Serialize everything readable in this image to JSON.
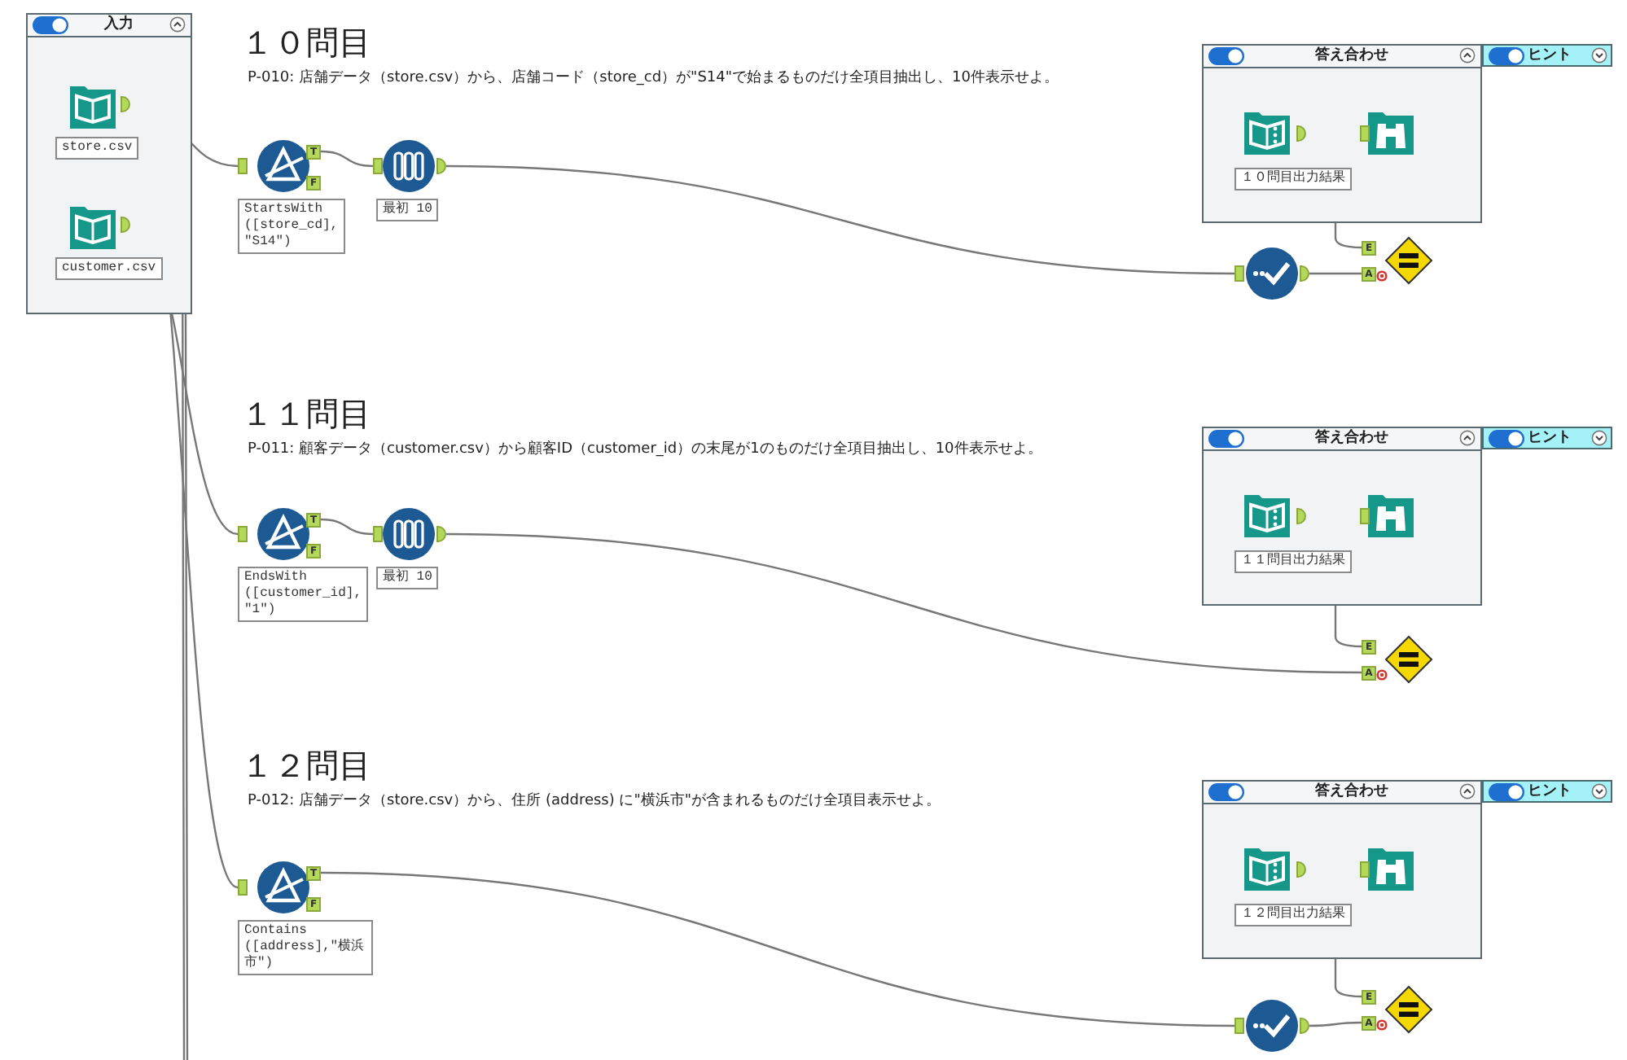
{
  "input_container": {
    "title": "入力",
    "on": true,
    "expanded": true,
    "tools": [
      {
        "kind": "input",
        "label": "store.csv"
      },
      {
        "kind": "input",
        "label": "customer.csv"
      }
    ]
  },
  "questions": [
    {
      "title": "１０問目",
      "description": "P-010: 店舗データ（store.csv）から、店舗コード（store_cd）が\"S14\"で始まるものだけ全項目抽出し、10件表示せよ。",
      "nodes": [
        {
          "kind": "filter",
          "label": "StartsWith\n([store_cd],\n\"S14\")",
          "ports": [
            "T",
            "F"
          ]
        },
        {
          "kind": "sample",
          "label": "最初 10"
        },
        {
          "kind": "check"
        }
      ],
      "answer": {
        "title": "答え合わせ",
        "on": true,
        "expanded": true,
        "result_label": "１０問目出力結果"
      },
      "compare_ports": [
        "E",
        "A"
      ],
      "hint": {
        "title": "ヒント",
        "on": true,
        "expanded": false
      }
    },
    {
      "title": "１１問目",
      "description": "P-011: 顧客データ（customer.csv）から顧客ID（customer_id）の末尾が1のものだけ全項目抽出し、10件表示せよ。",
      "nodes": [
        {
          "kind": "filter",
          "label": "EndsWith\n([customer_id],\n\"1\")",
          "ports": [
            "T",
            "F"
          ]
        },
        {
          "kind": "sample",
          "label": "最初 10"
        }
      ],
      "answer": {
        "title": "答え合わせ",
        "on": true,
        "expanded": true,
        "result_label": "１１問目出力結果"
      },
      "compare_ports": [
        "E",
        "A"
      ],
      "hint": {
        "title": "ヒント",
        "on": true,
        "expanded": false
      }
    },
    {
      "title": "１２問目",
      "description": "P-012: 店舗データ（store.csv）から、住所 (address) に\"横浜市\"が含まれるものだけ全項目表示せよ。",
      "nodes": [
        {
          "kind": "filter",
          "label": "Contains\n([address],\"横浜市\")",
          "ports": [
            "T",
            "F"
          ]
        },
        {
          "kind": "check"
        }
      ],
      "answer": {
        "title": "答え合わせ",
        "on": true,
        "expanded": true,
        "result_label": "１２問目出力結果"
      },
      "compare_ports": [
        "E",
        "A"
      ],
      "hint": {
        "title": "ヒント",
        "on": true,
        "expanded": false
      }
    }
  ]
}
